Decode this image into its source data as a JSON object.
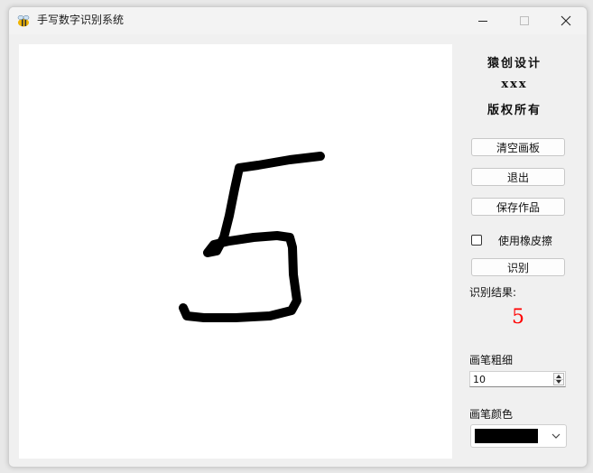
{
  "window": {
    "title": "手写数字识别系统"
  },
  "sidebar": {
    "credits": [
      "猿创设计",
      "xxx",
      "版权所有"
    ],
    "buttons": {
      "clear": "清空画板",
      "exit": "退出",
      "save": "保存作品",
      "recognize": "识别"
    },
    "eraser_label": "使用橡皮擦",
    "eraser_checked": false,
    "result_label": "识别结果:",
    "result_value": "5",
    "pen_width_label": "画笔粗细",
    "pen_width_value": "10",
    "pen_color_label": "画笔颜色",
    "pen_color": "#000000"
  },
  "colors": {
    "result": "#ff0000",
    "canvas_bg": "#ffffff",
    "stroke": "#000000"
  }
}
